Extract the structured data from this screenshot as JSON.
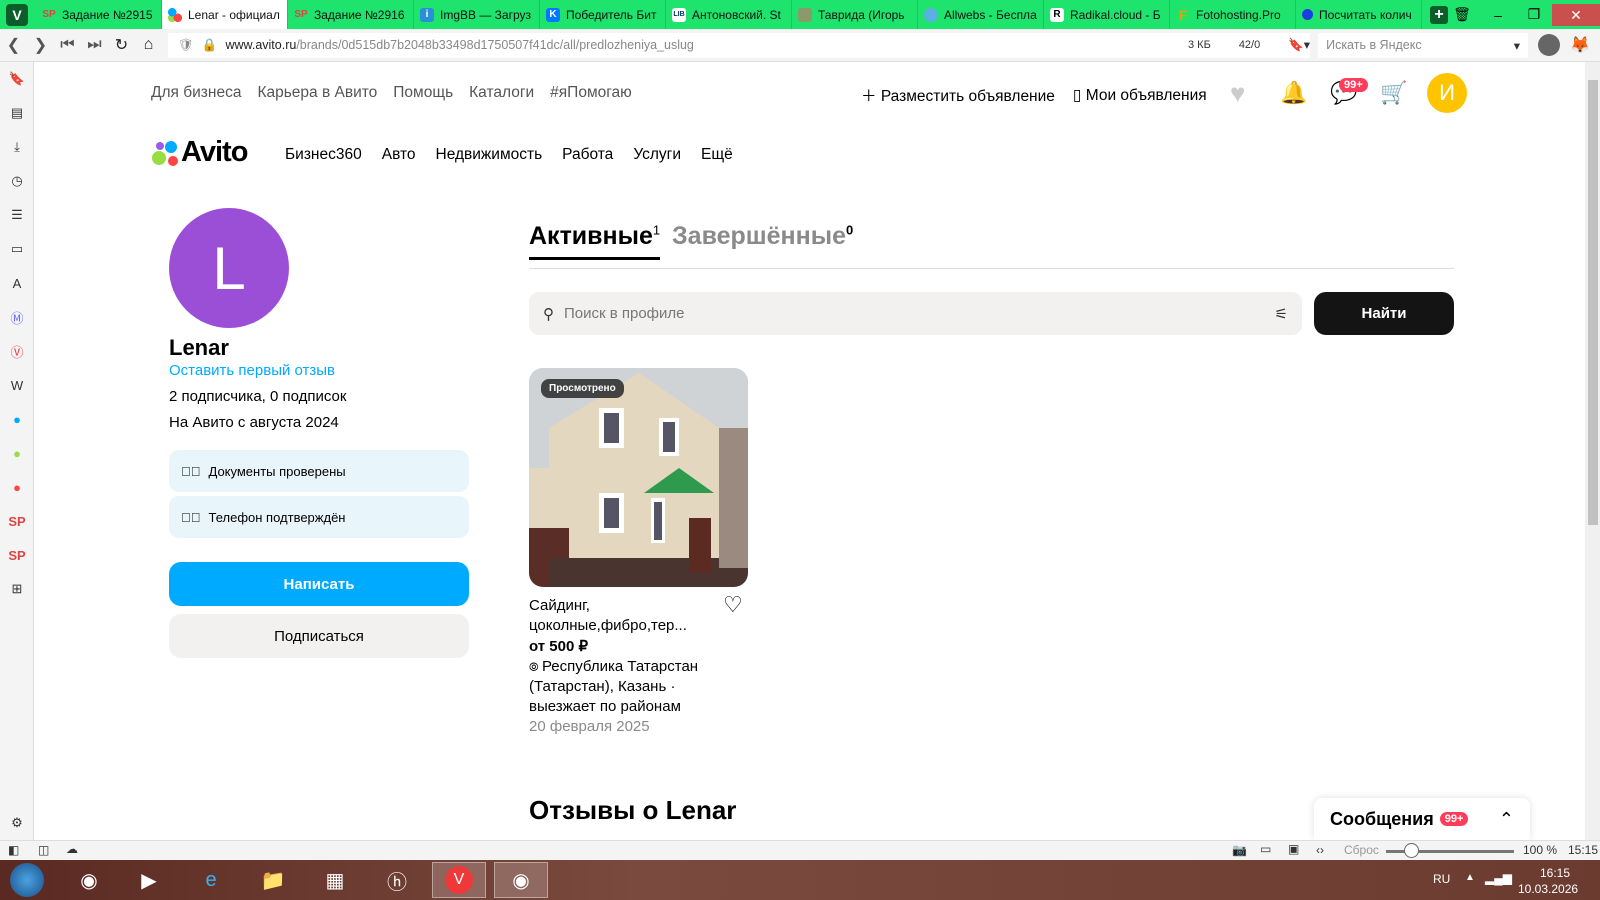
{
  "browser": {
    "tabs": [
      {
        "title": "Задание №2915",
        "icon": "SP"
      },
      {
        "title": "Lenar - официал",
        "icon": "avito"
      },
      {
        "title": "Задание №2916",
        "icon": "SP"
      },
      {
        "title": "ImgBB — Загруз",
        "icon": "ibb"
      },
      {
        "title": "Победитель Бит",
        "icon": "VK"
      },
      {
        "title": "Антоновский. St",
        "icon": "LIB"
      },
      {
        "title": "Таврида (Игорь",
        "icon": "img"
      },
      {
        "title": "Allwebs - Беспла",
        "icon": "globe"
      },
      {
        "title": "Radikal.cloud - Б",
        "icon": "R"
      },
      {
        "title": "Fotohosting.Pro",
        "icon": "F"
      },
      {
        "title": "Посчитать колич",
        "icon": "dot"
      }
    ],
    "url_domain": "www.avito.ru",
    "url_path": "/brands/0d515db7b2048b33498d1750507f41dc/all/predlozheniya_uslug",
    "page_size": "3 КБ",
    "counter": "42/0",
    "search_placeholder": "Искать в Яндекс",
    "status": {
      "reset": "Сброс",
      "zoom": "100 %",
      "time": "15:15"
    },
    "sidebar_sp1": "SP",
    "sidebar_sp2": "SP",
    "sidebar_w": "W"
  },
  "taskbar": {
    "lang": "RU",
    "time": "16:15",
    "date": "10.03.2026"
  },
  "header": {
    "top_links": [
      "Для бизнеса",
      "Карьера в Авито",
      "Помощь",
      "Каталоги",
      "#яПомогаю"
    ],
    "post_ad": "Разместить объявление",
    "my_ads": "Мои объявления",
    "messages_badge": "99+",
    "user_initial": "И",
    "logo": "Avito",
    "categories": [
      "Бизнес360",
      "Авто",
      "Недвижимость",
      "Работа",
      "Услуги",
      "Ещё"
    ]
  },
  "profile": {
    "initial": "L",
    "name": "Lenar",
    "review_link": "Оставить первый отзыв",
    "subs": "2 подписчика, 0 подписок",
    "since": "На Авито с августа 2024",
    "badges": [
      "Документы проверены",
      "Телефон подтверждён"
    ],
    "write": "Написать",
    "subscribe": "Подписаться"
  },
  "listings": {
    "tabs": [
      {
        "label": "Активные",
        "count": "1"
      },
      {
        "label": "Завершённые",
        "count": "0"
      }
    ],
    "search_placeholder": "Поиск в профиле",
    "find": "Найти",
    "items": [
      {
        "viewed": "Просмотрено",
        "title1": "Сайдинг,",
        "title2": "цоколные,фибро,тер...",
        "price": "от 500 ₽",
        "loc1": "Республика Татарстан",
        "loc2": "(Татарстан), Казань ·",
        "loc3": "выезжает по районам",
        "date": "20 февраля 2025"
      }
    ]
  },
  "reviews_title": "Отзывы о Lenar",
  "messenger": {
    "title": "Сообщения",
    "badge": "99+"
  },
  "colors": {
    "accent": "#00aaff",
    "avatar": "#9b4fd6",
    "tabbar": "#1ee46e"
  }
}
